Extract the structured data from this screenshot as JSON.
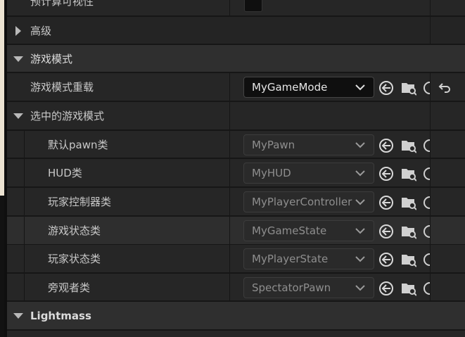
{
  "rows": {
    "precompute_visibility": {
      "label": "预计算可视性"
    },
    "advanced": {
      "label": "高级"
    },
    "game_mode_category": {
      "label": "游戏模式"
    },
    "game_mode_override": {
      "label": "游戏模式重载",
      "value": "MyGameMode"
    },
    "selected_game_mode": {
      "label": "选中的游戏模式"
    },
    "default_pawn": {
      "label": "默认pawn类",
      "value": "MyPawn"
    },
    "hud": {
      "label": "HUD类",
      "value": "MyHUD"
    },
    "player_controller": {
      "label": "玩家控制器类",
      "value": "MyPlayerController"
    },
    "game_state": {
      "label": "游戏状态类",
      "value": "MyGameState"
    },
    "player_state": {
      "label": "玩家状态类",
      "value": "MyPlayerState"
    },
    "spectator": {
      "label": "旁观者类",
      "value": "SpectatorPawn"
    },
    "lightmass": {
      "label": "Lightmass"
    }
  },
  "icons": {
    "use_selected": "back-arrow-circle-icon",
    "browse": "folder-search-icon",
    "reset": "reset-arrow-icon"
  },
  "colors": {
    "background": "#202020",
    "category_row": "#2f2f2f",
    "property_row": "#262626",
    "text": "#c8c8c8",
    "combo_disabled_text": "#8e8e8e"
  }
}
